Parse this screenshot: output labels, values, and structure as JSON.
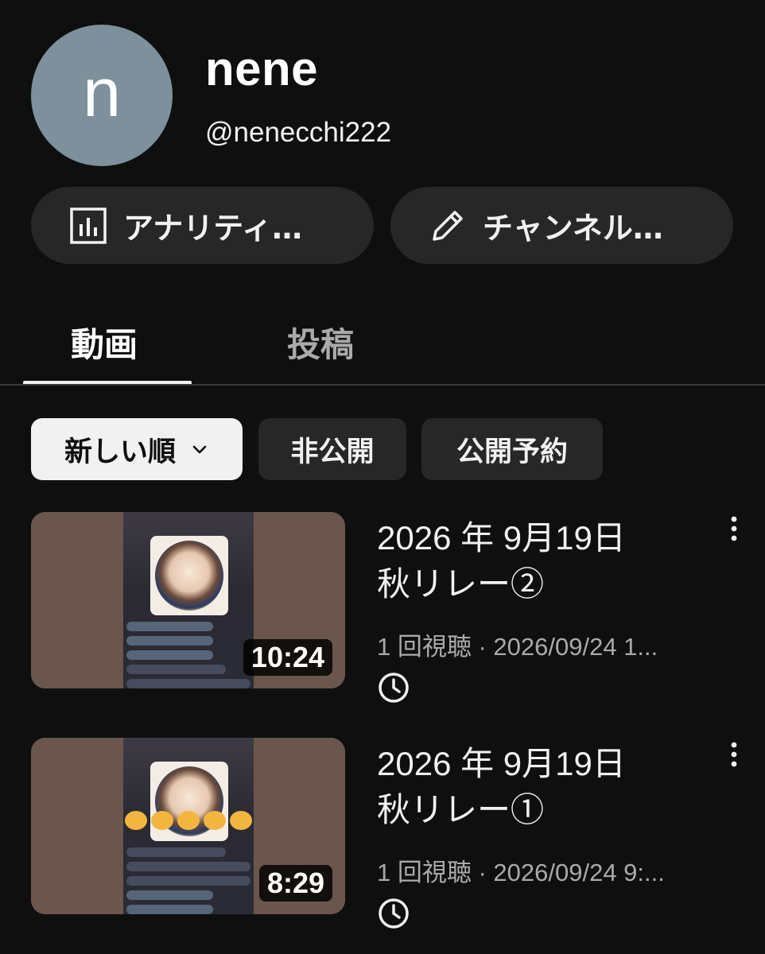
{
  "channel": {
    "avatar_letter": "n",
    "avatar_color": "#7d909c",
    "name": "nene",
    "handle": "@nenecchi222"
  },
  "actions": {
    "analytics_label": "アナリティ…",
    "analytics_icon": "bar-chart-icon",
    "channel_label": "チャンネル…",
    "channel_icon": "pencil-icon"
  },
  "tabs": [
    {
      "label": "動画",
      "active": true
    },
    {
      "label": "投稿",
      "active": false
    }
  ],
  "filters": {
    "sort_label": "新しい順",
    "private_label": "非公開",
    "scheduled_label": "公開予約"
  },
  "videos": [
    {
      "title_line1": "2026 年 9月19日",
      "title_line2": "秋リレー②",
      "duration": "10:24",
      "meta": "1 回視聴 · 2026/09/24 1...",
      "status_icon": "clock-icon",
      "menu_icon": "more-vert-icon"
    },
    {
      "title_line1": "2026 年 9月19日",
      "title_line2": "秋リレー①",
      "duration": "8:29",
      "meta": "1 回視聴 · 2026/09/24 9:...",
      "status_icon": "clock-icon",
      "menu_icon": "more-vert-icon"
    }
  ]
}
